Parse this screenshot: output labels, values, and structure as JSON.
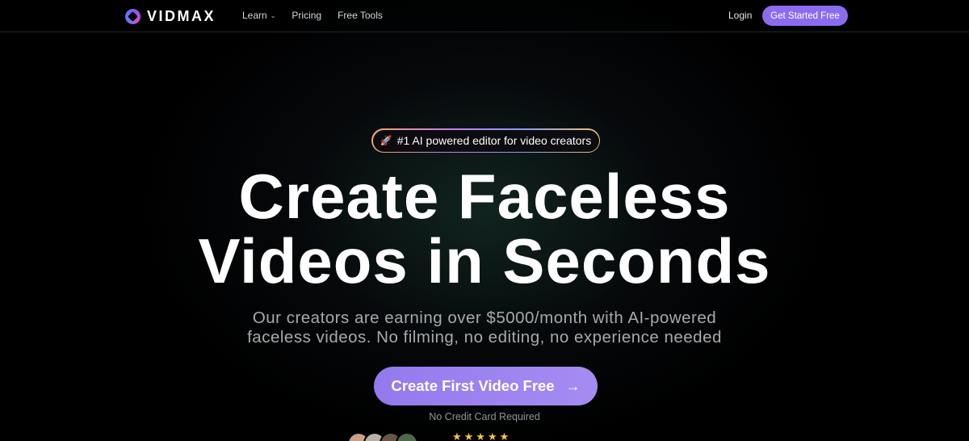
{
  "nav": {
    "logo_text": "VIDMAX",
    "links": [
      {
        "label": "Learn",
        "has_dropdown": true
      },
      {
        "label": "Pricing"
      },
      {
        "label": "Free Tools"
      }
    ],
    "login_label": "Login",
    "cta_label": "Get Started Free"
  },
  "hero": {
    "badge_icon": "rocket-icon",
    "badge_text": "#1 AI powered editor for video creators",
    "headline_line1": "Create Faceless",
    "headline_line2": "Videos in Seconds",
    "subtitle_line1": "Our creators are earning over $5000/month with AI-powered",
    "subtitle_line2": "faceless videos. No filming, no editing, no experience needed",
    "cta_label": "Create First Video Free",
    "cta_icon": "arrow-right-icon",
    "cta_arrow": "→",
    "note": "No Credit Card Required"
  },
  "social_proof": {
    "avatar_count": 4,
    "rating_stars": 5,
    "stars_text": "★★★★★"
  },
  "colors": {
    "accent": "#8b6cf0",
    "cta_gradient_start": "#9479ee",
    "cta_gradient_end": "#a58cf2",
    "background": "#000000",
    "star": "#f5c542"
  }
}
